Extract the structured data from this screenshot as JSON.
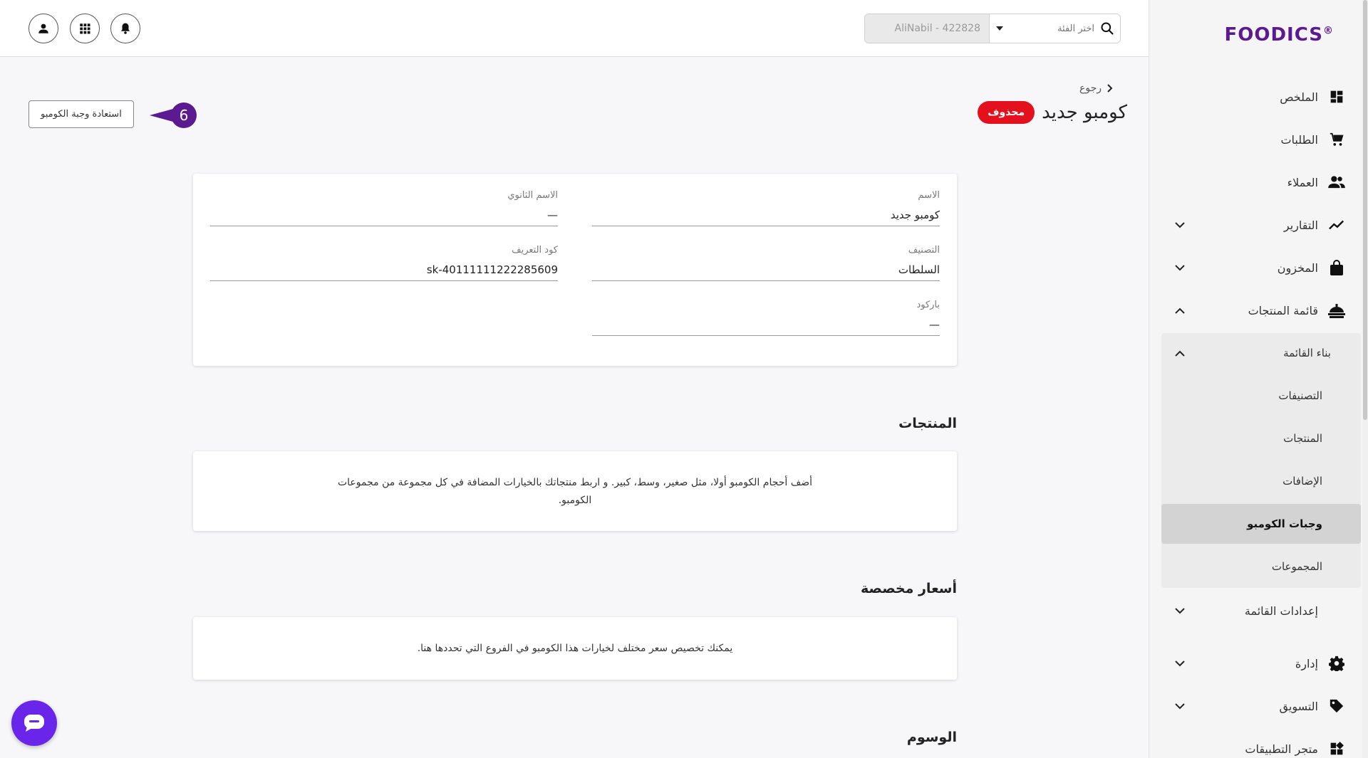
{
  "brand": {
    "logo_text": "FOODICS",
    "color": "#5b1a8f"
  },
  "topbar": {
    "search_placeholder": "اختر الفئة",
    "account_label": "AliNabil - 422828",
    "icons": [
      "user-icon",
      "apps-grid-icon",
      "bell-icon"
    ]
  },
  "sidebar": {
    "items": [
      {
        "label": "الملخص",
        "icon": "dashboard-icon"
      },
      {
        "label": "الطلبات",
        "icon": "cart-icon"
      },
      {
        "label": "العملاء",
        "icon": "customers-icon"
      },
      {
        "label": "التقارير",
        "icon": "chart-line-icon"
      },
      {
        "label": "المخزون",
        "icon": "bag-icon"
      },
      {
        "label": "قائمة المنتجات",
        "icon": "menu-food-icon"
      },
      {
        "label": "إعدادات القائمة",
        "icon": ""
      },
      {
        "label": "إدارة",
        "icon": "gear-icon"
      },
      {
        "label": "التسويق",
        "icon": "tag-icon"
      },
      {
        "label": "متجر التطبيقات",
        "icon": "apps-icon"
      }
    ],
    "menu_builder": {
      "label": "بناء القائمة",
      "items": [
        "التصنيفات",
        "المنتجات",
        "الإضافات",
        "وجبات الكومبو",
        "المجموعات"
      ],
      "active": "وجبات الكومبو"
    }
  },
  "header": {
    "back_label": "رجوع",
    "title": "كومبو جديد",
    "status_badge": "محذوف",
    "status_color": "#e3101d",
    "restore_button": "استعادة وجبة الكومبو",
    "step_number": "6"
  },
  "details": {
    "name_label": "الاسم",
    "name_value": "كومبو جديد",
    "secondary_name_label": "الاسم الثانوي",
    "secondary_name_value": "—",
    "category_label": "التصنيف",
    "category_value": "السلطات",
    "sku_label": "كود التعريف",
    "sku_value": "sk-40111111222285609",
    "barcode_label": "باركود",
    "barcode_value": "—"
  },
  "products": {
    "title": "المنتجات",
    "message": "أضف أحجام الكومبو أولا، مثل صغير، وسط، كبير. و اربط منتجاتك بالخيارات المضافة في كل مجموعة من مجموعات الكومبو."
  },
  "custom_prices": {
    "title": "أسعار مخصصة",
    "message": "يمكنك تخصيص سعر مختلف لخيارات هذا الكومبو في الفروع التي تحددها هنا."
  },
  "tags": {
    "title": "الوسوم"
  },
  "accent_color": "#6a25ea"
}
